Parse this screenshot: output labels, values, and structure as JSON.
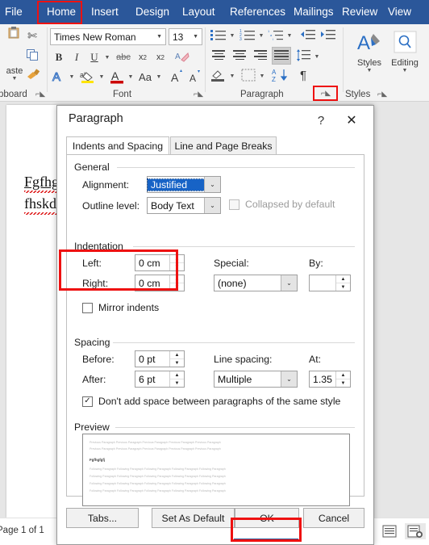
{
  "ribbon": {
    "tabs": [
      {
        "label": "File"
      },
      {
        "label": "Home"
      },
      {
        "label": "Insert"
      },
      {
        "label": "Design"
      },
      {
        "label": "Layout"
      },
      {
        "label": "References"
      },
      {
        "label": "Mailings"
      },
      {
        "label": "Review"
      },
      {
        "label": "View"
      }
    ],
    "groups": {
      "clipboard": "pboard",
      "font": "Font",
      "paragraph": "Paragraph",
      "styles": "Styles"
    },
    "paste_label": "aste",
    "font_name": "Times New Roman",
    "font_size": "13",
    "styles_label": "Styles",
    "editing_label": "Editing",
    "bold": "B",
    "italic": "I",
    "underline": "U",
    "strikethrough": "abc",
    "subscript": "x",
    "superscript": "x",
    "text_effects": "A",
    "highlight": "ab",
    "font_color": "A",
    "change_case": "Aa",
    "grow_font": "A",
    "shrink_font": "A",
    "sort": "A",
    "pilcrow": "¶"
  },
  "document": {
    "line1": "Fgfhg",
    "line2": "fhskdf"
  },
  "statusbar": {
    "page": "Page 1 of 1"
  },
  "dialog": {
    "title": "Paragraph",
    "help_icon": "?",
    "close_icon": "✕",
    "tabs": [
      {
        "label": "Indents and Spacing",
        "active": true
      },
      {
        "label": "Line and Page Breaks",
        "active": false
      }
    ],
    "general": {
      "section": "General",
      "alignment_label": "Alignment:",
      "alignment_value": "Justified",
      "outline_label": "Outline level:",
      "outline_value": "Body Text",
      "collapsed_label": "Collapsed by default",
      "collapsed_checked": false
    },
    "indentation": {
      "section": "Indentation",
      "left_label": "Left:",
      "left_value": "0 cm",
      "right_label": "Right:",
      "right_value": "0 cm",
      "special_label": "Special:",
      "special_value": "(none)",
      "by_label": "By:",
      "by_value": "",
      "mirror_label": "Mirror indents",
      "mirror_checked": false
    },
    "spacing": {
      "section": "Spacing",
      "before_label": "Before:",
      "before_value": "0 pt",
      "after_label": "After:",
      "after_value": "6 pt",
      "linespacing_label": "Line spacing:",
      "linespacing_value": "Multiple",
      "at_label": "At:",
      "at_value": "1.35",
      "dontadd_label": "Don't add space between paragraphs of the same style",
      "dontadd_checked": true
    },
    "preview": {
      "section": "Preview",
      "previous": "Previous Paragraph Previous Paragraph Previous Paragraph Previous Paragraph Previous Paragraph",
      "sample": "Fgfhgfgfj",
      "following": "Following Paragraph Following Paragraph Following Paragraph Following Paragraph Following Paragraph"
    },
    "buttons": {
      "tabs": "Tabs...",
      "set_default": "Set As Default",
      "ok": "OK",
      "cancel": "Cancel"
    }
  },
  "colors": {
    "ribbon_blue": "#2b579a",
    "highlight_red": "#ee1111",
    "select_blue": "#1763c6"
  }
}
